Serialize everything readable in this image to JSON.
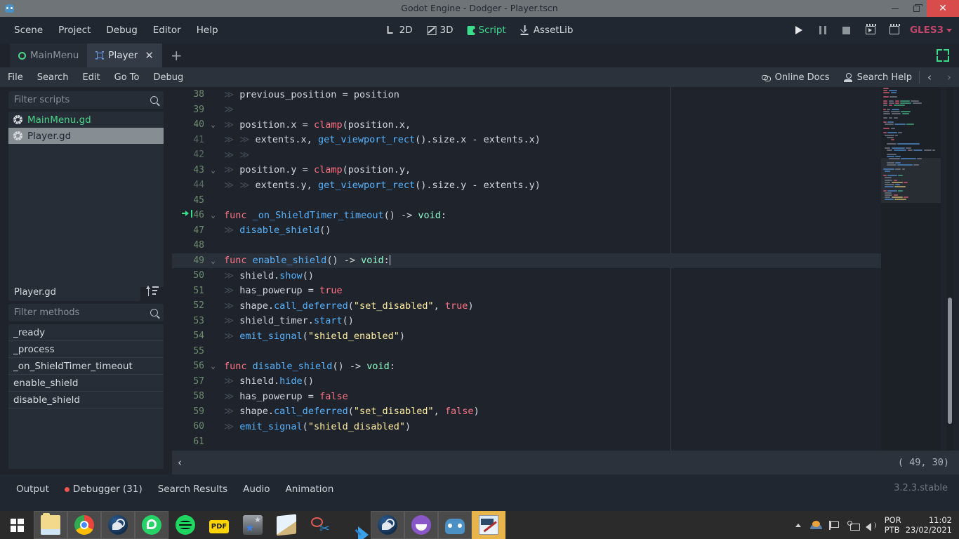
{
  "window": {
    "title": "Godot Engine - Dodger - Player.tscn",
    "app_icon": "godot-icon",
    "minimize": "minimize-icon",
    "maximize": "maximize-icon",
    "close": "close-icon"
  },
  "menubar": {
    "items": [
      "Scene",
      "Project",
      "Debug",
      "Editor",
      "Help"
    ],
    "modes": [
      {
        "label": "2D",
        "icon": "2d-icon",
        "active": false
      },
      {
        "label": "3D",
        "icon": "3d-icon",
        "active": false
      },
      {
        "label": "Script",
        "icon": "script-icon",
        "active": true
      },
      {
        "label": "AssetLib",
        "icon": "assetlib-icon",
        "active": false
      }
    ],
    "run_controls": [
      "play-icon",
      "pause-icon",
      "stop-icon",
      "play-scene-icon",
      "play-custom-scene-icon"
    ],
    "renderer": "GLES3",
    "accent_green": "#3ddb8c",
    "accent_pink": "#c2456b"
  },
  "script_tabs": {
    "tabs": [
      {
        "label": "MainMenu",
        "icon": "circle-node-icon",
        "active": false,
        "closable": false
      },
      {
        "label": "Player",
        "icon": "area2d-node-icon",
        "active": true,
        "closable": true
      }
    ],
    "close_label": "✕",
    "add_label": "+",
    "expand_icon": "expand-icon"
  },
  "script_menu": {
    "items": [
      "File",
      "Search",
      "Edit",
      "Go To",
      "Debug"
    ],
    "online_docs": "Online Docs",
    "search_help": "Search Help",
    "nav_prev": "‹",
    "nav_next": "›"
  },
  "left_panel": {
    "filter_scripts_placeholder": "Filter scripts",
    "scripts": [
      {
        "name": "MainMenu.gd",
        "selected": false,
        "color": "#4bd688"
      },
      {
        "name": "Player.gd",
        "selected": true,
        "color": "#1f242c"
      }
    ],
    "current_script": "Player.gd",
    "sort_icon": "sort-icon",
    "filter_methods_placeholder": "Filter methods",
    "methods": [
      "_ready",
      "_process",
      "_on_ShieldTimer_timeout",
      "enable_shield",
      "disable_shield"
    ]
  },
  "editor": {
    "cursor_position": "( 49, 30)",
    "collapse_label": "‹",
    "current_line": 49,
    "lines": [
      {
        "n": 38,
        "fold": "",
        "mark": "",
        "tabs": 1,
        "tokens": [
          {
            "t": "previous_position = position",
            "c": "plain"
          }
        ]
      },
      {
        "n": 39,
        "fold": "",
        "mark": "",
        "tabs": 1,
        "tokens": []
      },
      {
        "n": 40,
        "fold": "⌄",
        "mark": "",
        "tabs": 1,
        "tokens": [
          {
            "t": "position.x = ",
            "c": "plain"
          },
          {
            "t": "clamp",
            "c": "kw"
          },
          {
            "t": "(position.x,",
            "c": "plain"
          }
        ]
      },
      {
        "n": 41,
        "fold": "",
        "mark": "",
        "dim": true,
        "tabs": 2,
        "tokens": [
          {
            "t": "extents.x, ",
            "c": "plain"
          },
          {
            "t": "get_viewport_rect",
            "c": "fn"
          },
          {
            "t": "().size.x - extents.x)",
            "c": "plain"
          }
        ]
      },
      {
        "n": 42,
        "fold": "",
        "mark": "",
        "dim": true,
        "tabs": 2,
        "tokens": []
      },
      {
        "n": 43,
        "fold": "⌄",
        "mark": "",
        "tabs": 1,
        "tokens": [
          {
            "t": "position.y = ",
            "c": "plain"
          },
          {
            "t": "clamp",
            "c": "kw"
          },
          {
            "t": "(position.y,",
            "c": "plain"
          }
        ]
      },
      {
        "n": 44,
        "fold": "",
        "mark": "",
        "dim": true,
        "tabs": 2,
        "tokens": [
          {
            "t": "extents.y, ",
            "c": "plain"
          },
          {
            "t": "get_viewport_rect",
            "c": "fn"
          },
          {
            "t": "().size.y - extents.y)",
            "c": "plain"
          }
        ]
      },
      {
        "n": 45,
        "fold": "",
        "mark": "",
        "tabs": 0,
        "tokens": []
      },
      {
        "n": 46,
        "fold": "⌄",
        "mark": "connection-slot-icon",
        "tabs": 0,
        "tokens": [
          {
            "t": "func ",
            "c": "kw"
          },
          {
            "t": "_on_ShieldTimer_timeout",
            "c": "fn"
          },
          {
            "t": "() -> ",
            "c": "plain"
          },
          {
            "t": "void",
            "c": "type"
          },
          {
            "t": ":",
            "c": "plain"
          }
        ]
      },
      {
        "n": 47,
        "fold": "",
        "mark": "",
        "tabs": 1,
        "tokens": [
          {
            "t": "disable_shield",
            "c": "fn"
          },
          {
            "t": "()",
            "c": "plain"
          }
        ]
      },
      {
        "n": 48,
        "fold": "",
        "mark": "",
        "tabs": 0,
        "tokens": []
      },
      {
        "n": 49,
        "fold": "⌄",
        "mark": "",
        "tabs": 0,
        "current": true,
        "cursor": true,
        "tokens": [
          {
            "t": "func ",
            "c": "kw"
          },
          {
            "t": "enable_shield",
            "c": "fn"
          },
          {
            "t": "() -> ",
            "c": "plain"
          },
          {
            "t": "void",
            "c": "type"
          },
          {
            "t": ":",
            "c": "plain"
          }
        ]
      },
      {
        "n": 50,
        "fold": "",
        "mark": "",
        "tabs": 1,
        "tokens": [
          {
            "t": "shield.",
            "c": "plain"
          },
          {
            "t": "show",
            "c": "fn"
          },
          {
            "t": "()",
            "c": "plain"
          }
        ]
      },
      {
        "n": 51,
        "fold": "",
        "mark": "",
        "tabs": 1,
        "tokens": [
          {
            "t": "has_powerup = ",
            "c": "plain"
          },
          {
            "t": "true",
            "c": "kw"
          }
        ]
      },
      {
        "n": 52,
        "fold": "",
        "mark": "",
        "tabs": 1,
        "tokens": [
          {
            "t": "shape.",
            "c": "plain"
          },
          {
            "t": "call_deferred",
            "c": "fn"
          },
          {
            "t": "(",
            "c": "plain"
          },
          {
            "t": "\"set_disabled\"",
            "c": "str"
          },
          {
            "t": ", ",
            "c": "plain"
          },
          {
            "t": "true",
            "c": "kw"
          },
          {
            "t": ")",
            "c": "plain"
          }
        ]
      },
      {
        "n": 53,
        "fold": "",
        "mark": "",
        "tabs": 1,
        "tokens": [
          {
            "t": "shield_timer.",
            "c": "plain"
          },
          {
            "t": "start",
            "c": "fn"
          },
          {
            "t": "()",
            "c": "plain"
          }
        ]
      },
      {
        "n": 54,
        "fold": "",
        "mark": "",
        "tabs": 1,
        "tokens": [
          {
            "t": "emit_signal",
            "c": "fn"
          },
          {
            "t": "(",
            "c": "plain"
          },
          {
            "t": "\"shield_enabled\"",
            "c": "str"
          },
          {
            "t": ")",
            "c": "plain"
          }
        ]
      },
      {
        "n": 55,
        "fold": "",
        "mark": "",
        "tabs": 0,
        "tokens": []
      },
      {
        "n": 56,
        "fold": "⌄",
        "mark": "",
        "tabs": 0,
        "tokens": [
          {
            "t": "func ",
            "c": "kw"
          },
          {
            "t": "disable_shield",
            "c": "fn"
          },
          {
            "t": "() -> ",
            "c": "plain"
          },
          {
            "t": "void",
            "c": "type"
          },
          {
            "t": ":",
            "c": "plain"
          }
        ]
      },
      {
        "n": 57,
        "fold": "",
        "mark": "",
        "tabs": 1,
        "tokens": [
          {
            "t": "shield.",
            "c": "plain"
          },
          {
            "t": "hide",
            "c": "fn"
          },
          {
            "t": "()",
            "c": "plain"
          }
        ]
      },
      {
        "n": 58,
        "fold": "",
        "mark": "",
        "tabs": 1,
        "tokens": [
          {
            "t": "has_powerup = ",
            "c": "plain"
          },
          {
            "t": "false",
            "c": "kw"
          }
        ]
      },
      {
        "n": 59,
        "fold": "",
        "mark": "",
        "tabs": 1,
        "tokens": [
          {
            "t": "shape.",
            "c": "plain"
          },
          {
            "t": "call_deferred",
            "c": "fn"
          },
          {
            "t": "(",
            "c": "plain"
          },
          {
            "t": "\"set_disabled\"",
            "c": "str"
          },
          {
            "t": ", ",
            "c": "plain"
          },
          {
            "t": "false",
            "c": "kw"
          },
          {
            "t": ")",
            "c": "plain"
          }
        ]
      },
      {
        "n": 60,
        "fold": "",
        "mark": "",
        "tabs": 1,
        "tokens": [
          {
            "t": "emit_signal",
            "c": "fn"
          },
          {
            "t": "(",
            "c": "plain"
          },
          {
            "t": "\"shield_disabled\"",
            "c": "str"
          },
          {
            "t": ")",
            "c": "plain"
          }
        ]
      },
      {
        "n": 61,
        "fold": "",
        "mark": "",
        "tabs": 0,
        "tokens": []
      }
    ],
    "colors": {
      "background": "#1f242c",
      "keyword": "#ff7385",
      "function": "#57b3ff",
      "string": "#ffeda1",
      "type": "#8ffbc8",
      "line_number": "#6f8b6f",
      "current_line": "#2a303a"
    }
  },
  "bottom_dock": {
    "tabs": [
      {
        "label": "Output",
        "badge": false
      },
      {
        "label": "Debugger (31)",
        "badge": true
      },
      {
        "label": "Search Results",
        "badge": false
      },
      {
        "label": "Audio",
        "badge": false
      },
      {
        "label": "Animation",
        "badge": false
      }
    ],
    "version": "3.2.3.stable"
  },
  "taskbar": {
    "start": "windows-start-icon",
    "apps": [
      {
        "name": "file-explorer",
        "icon": "folder-icon",
        "state": "open"
      },
      {
        "name": "google-chrome",
        "icon": "chrome-icon",
        "state": "open"
      },
      {
        "name": "steam",
        "icon": "steam-icon",
        "state": "open"
      },
      {
        "name": "whatsapp",
        "icon": "whatsapp-icon",
        "state": "open"
      },
      {
        "name": "spotify",
        "icon": "spotify-icon",
        "state": "pinned"
      },
      {
        "name": "pdf-reader",
        "icon": "pdf-icon",
        "state": "pinned",
        "label": "PDF"
      },
      {
        "name": "favorites",
        "icon": "star-icon",
        "state": "pinned"
      },
      {
        "name": "notepad",
        "icon": "notepad-icon",
        "state": "pinned"
      },
      {
        "name": "snipping-tool",
        "icon": "scissors-icon",
        "state": "pinned"
      },
      {
        "name": "visual-studio-code",
        "icon": "vscode-icon",
        "state": "pinned"
      },
      {
        "name": "steam-window",
        "icon": "steam-icon",
        "state": "open"
      },
      {
        "name": "github-desktop",
        "icon": "github-icon",
        "state": "open"
      },
      {
        "name": "godot-engine",
        "icon": "godot-icon",
        "state": "open"
      },
      {
        "name": "paint",
        "icon": "paint-icon",
        "state": "active"
      }
    ],
    "tray": {
      "show_hidden": "caret-up-icon",
      "onedrive": "onedrive-icon",
      "flag": "security-flag-icon",
      "network": "network-icon",
      "volume": "volume-icon",
      "locale_top": "POR",
      "locale_bottom": "PTB",
      "time": "11:02",
      "date": "23/02/2021"
    }
  }
}
